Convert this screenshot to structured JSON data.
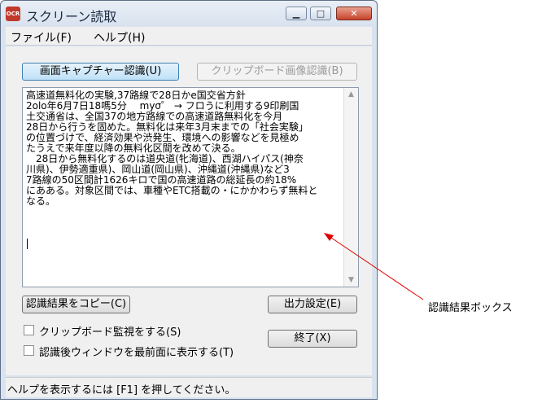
{
  "window": {
    "title": "スクリーン読取",
    "icon": "ocr-app-icon"
  },
  "menu": [
    {
      "label": "ファイル(F)"
    },
    {
      "label": "ヘルプ(H)"
    }
  ],
  "buttons": {
    "capture": "画面キャプチャー認識(U)",
    "clipboard": "クリップボード画像認識(B)",
    "copy": "認識結果をコピー(C)",
    "output": "出力設定(E)",
    "exit": "終了(X)"
  },
  "recognized_text": "高速道無料化の実験,37路線で28日かe国交省方針\n2olo年6月7日18嗎5分　 myσ゜ → フロうに利用する9印刷国\n土交通省は、全国37の地方路線での高速道路無料化を今月\n28日から行うを固めた。無料化は来年3月末までの「社会実験」\nの位置づけで、経済効果や渋発生、環境への影響などを見極め\nたうえで来年度以降の無料化区間を改めて決る。\n　28日から無料化するのは道央道(牝海道)、西湖ハイパス(神奈\n川県)、伊勢適重県)、岡山道(岡山県)、沖縄道(沖縄県)など3\n7路線の50区間計1626キロで国の高速道路の総延長の約18%\nにあある。対象区間では、車種やETC搭載の・にかかわらず無料と\nなる。",
  "checkboxes": {
    "monitor": "クリップボード監視をする(S)",
    "front": "認識後ウィンドウを最前面に表示する(T)"
  },
  "status": "ヘルプを表示するには [F1] を押してください。",
  "annotation": "認識結果ボックス",
  "colors": {
    "arrow": "#e00000",
    "accent": "#3c7fb1"
  }
}
